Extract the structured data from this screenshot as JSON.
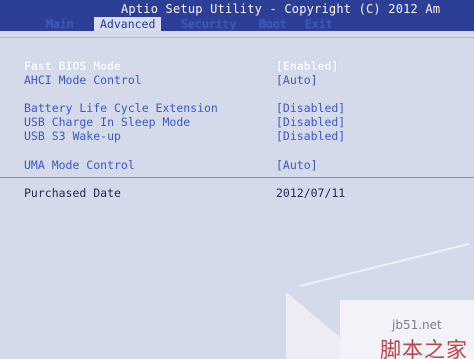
{
  "title": "Aptio Setup Utility - Copyright (C) 2012 Am",
  "tabs": [
    {
      "label": "Main",
      "active": false
    },
    {
      "label": "Advanced",
      "active": true
    },
    {
      "label": "Security",
      "active": false
    },
    {
      "label": "Boot",
      "active": false
    },
    {
      "label": "Exit",
      "active": false
    }
  ],
  "settings": [
    {
      "label": "Fast BIOS Mode",
      "value": "[Enabled]"
    },
    {
      "label": "AHCI Mode Control",
      "value": "[Auto]"
    },
    {
      "label": "Battery Life Cycle Extension",
      "value": "[Disabled]"
    },
    {
      "label": "USB Charge In Sleep Mode",
      "value": "[Disabled]"
    },
    {
      "label": "USB S3 Wake-up",
      "value": "[Disabled]"
    },
    {
      "label": "UMA Mode Control",
      "value": "[Auto]"
    }
  ],
  "info": {
    "label": "Purchased Date",
    "value": "2012/07/11"
  },
  "watermark": {
    "site": "jb51.net",
    "text": "脚本之家"
  },
  "colors": {
    "header": "#2c3e96",
    "item_text": "#3c59c0",
    "selected_text": "#ffffff",
    "info_text": "#1f2a56",
    "separator": "#d86a6a"
  }
}
